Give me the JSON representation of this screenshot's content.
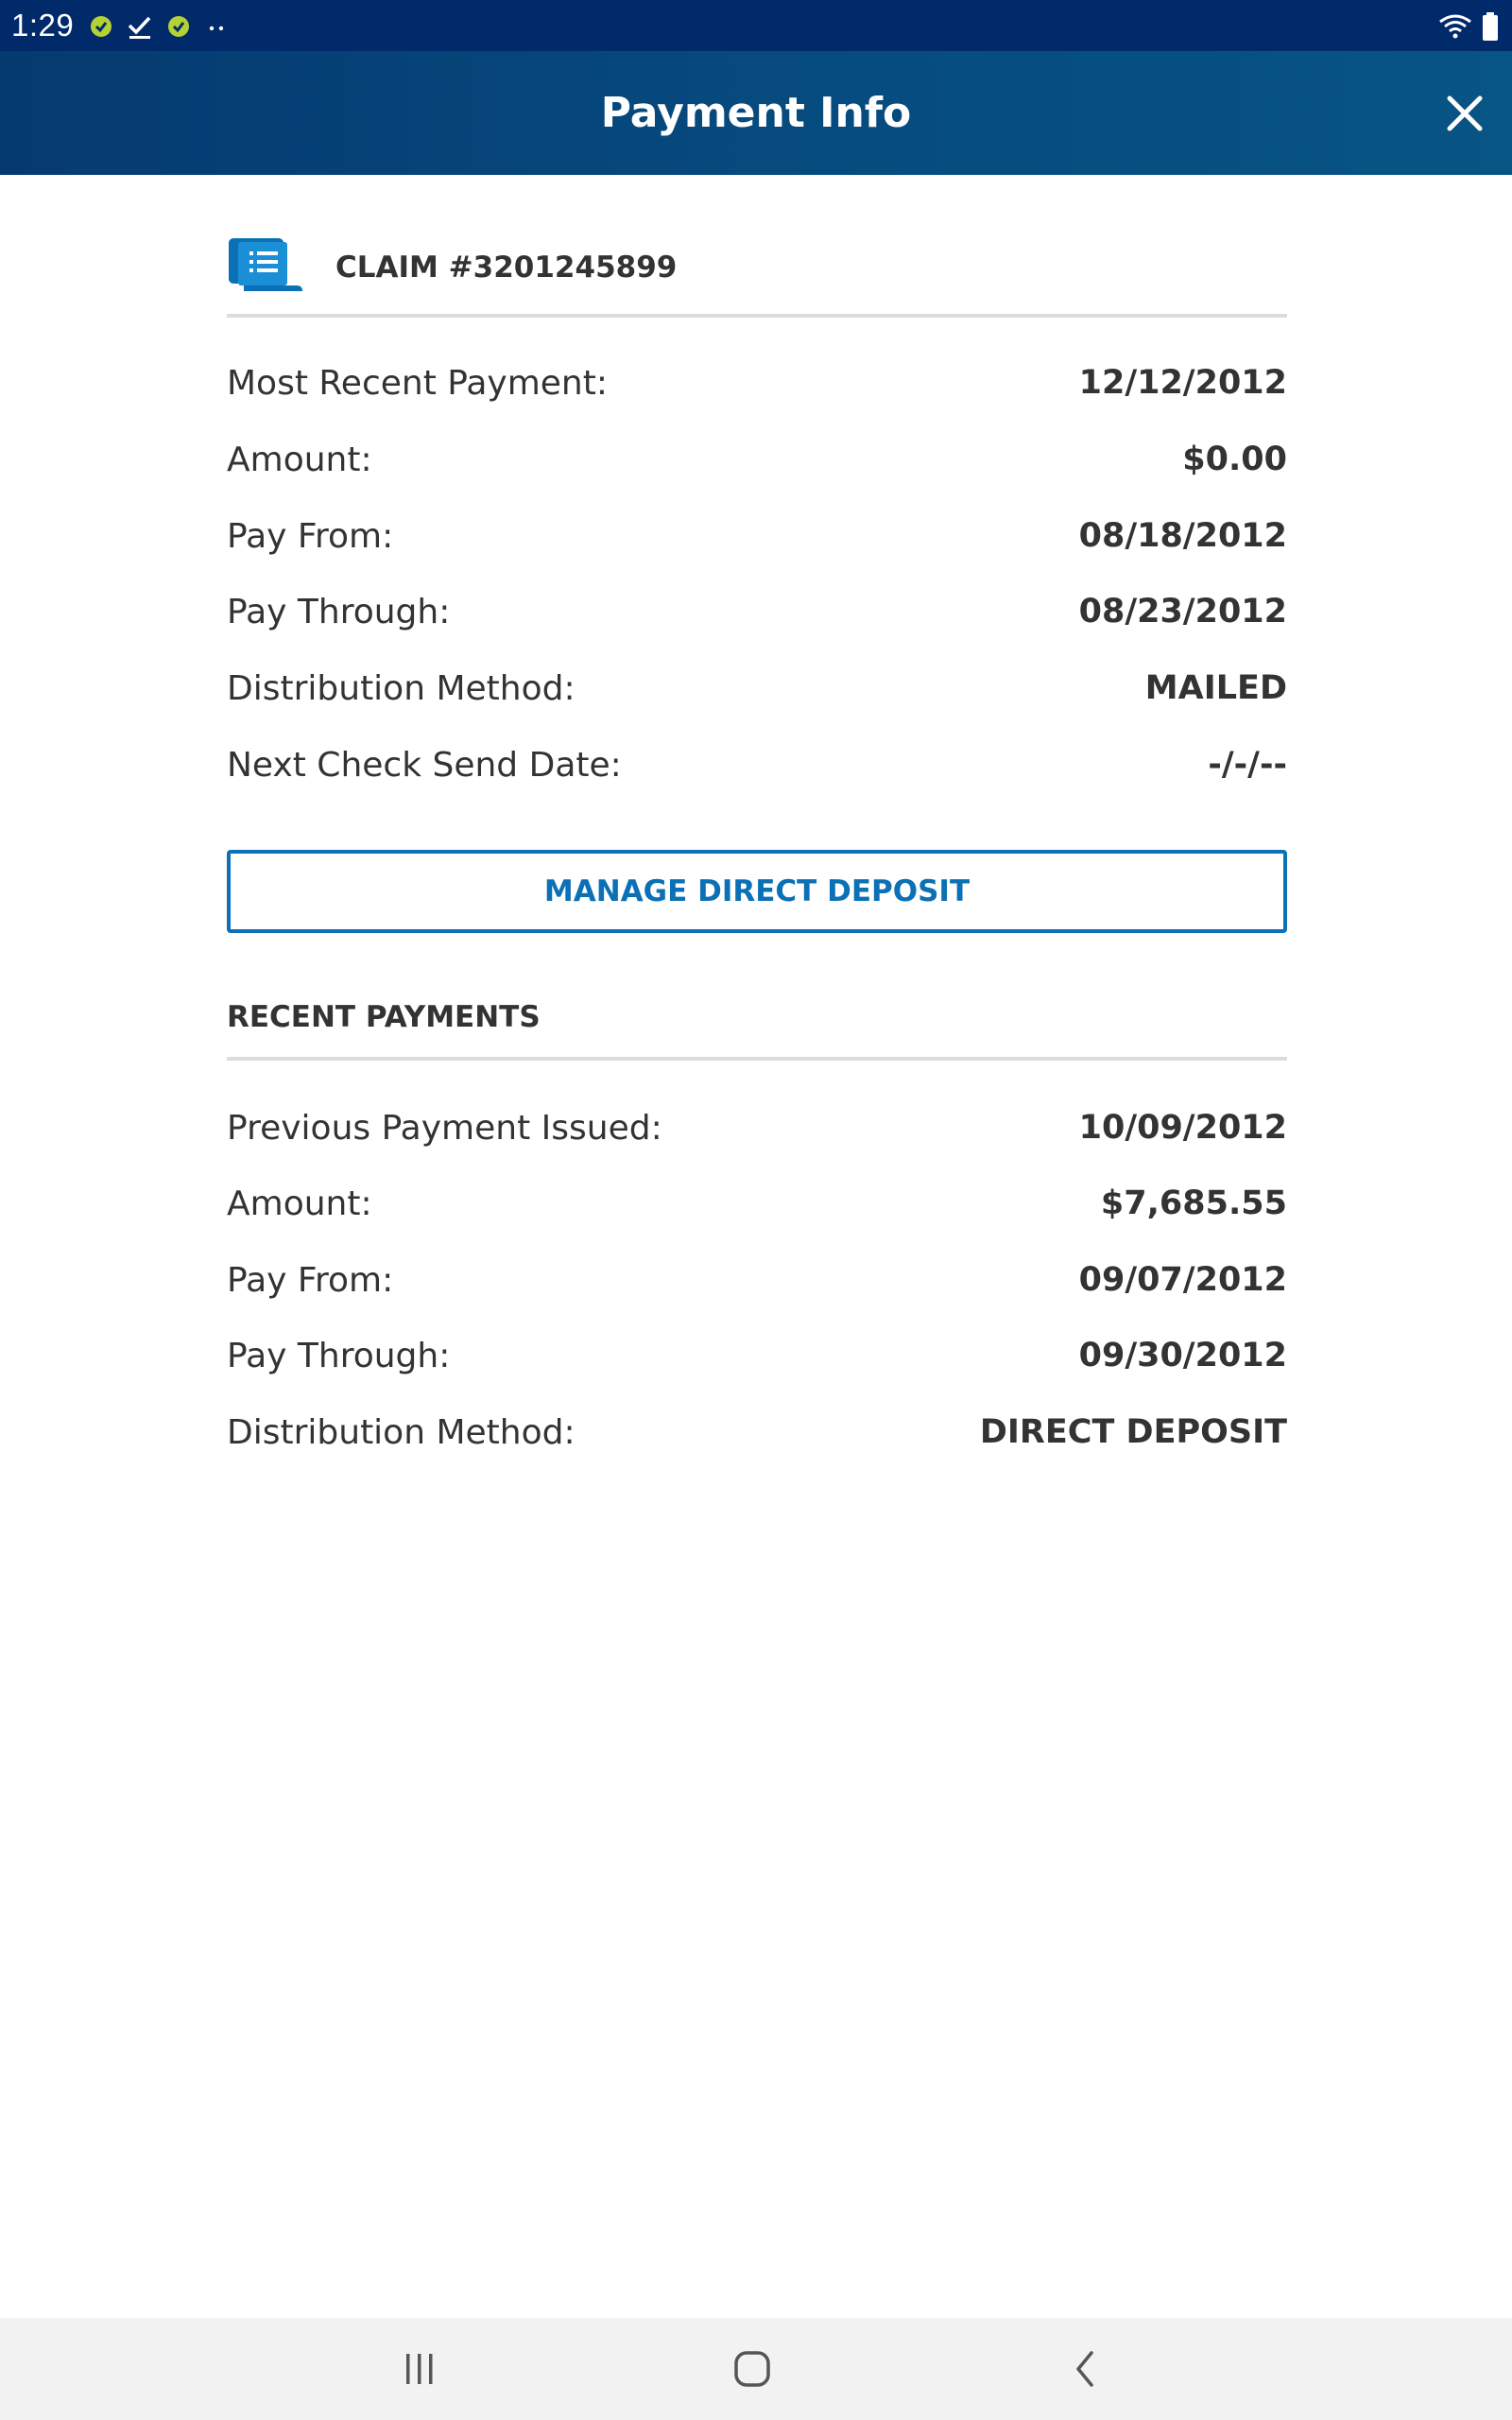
{
  "status_bar": {
    "time": "1:29",
    "icons": [
      "app-notification-icon",
      "checkmark-icon",
      "app-notification-icon",
      "more-dots-icon",
      "wifi-icon",
      "battery-icon"
    ]
  },
  "app_bar": {
    "title": "Payment Info",
    "close_icon": "close-icon"
  },
  "claim": {
    "icon": "scroll-document-icon",
    "label": "CLAIM #3201245899"
  },
  "current_payment": [
    {
      "label": "Most Recent Payment:",
      "value": "12/12/2012"
    },
    {
      "label": "Amount:",
      "value": "$0.00"
    },
    {
      "label": "Pay From:",
      "value": "08/18/2012"
    },
    {
      "label": "Pay Through:",
      "value": "08/23/2012"
    },
    {
      "label": "Distribution Method:",
      "value": "MAILED"
    },
    {
      "label": "Next Check Send Date:",
      "value": "-/-/--"
    }
  ],
  "manage_button": {
    "label": "MANAGE DIRECT DEPOSIT"
  },
  "recent_payments": {
    "title": "RECENT PAYMENTS",
    "rows": [
      {
        "label": "Previous Payment Issued:",
        "value": "10/09/2012"
      },
      {
        "label": "Amount:",
        "value": "$7,685.55"
      },
      {
        "label": "Pay From:",
        "value": "09/07/2012"
      },
      {
        "label": "Pay Through:",
        "value": "09/30/2012"
      },
      {
        "label": "Distribution Method:",
        "value": "DIRECT DEPOSIT"
      }
    ]
  },
  "nav_bar": {
    "icons": [
      "recent-apps-icon",
      "home-icon",
      "back-icon"
    ]
  },
  "colors": {
    "status_bar": "#012a6b",
    "app_bar": "#064a7e",
    "accent": "#0b70b5",
    "icon_green": "#b4d235",
    "text": "#333333",
    "divider": "#dcdcdc"
  }
}
